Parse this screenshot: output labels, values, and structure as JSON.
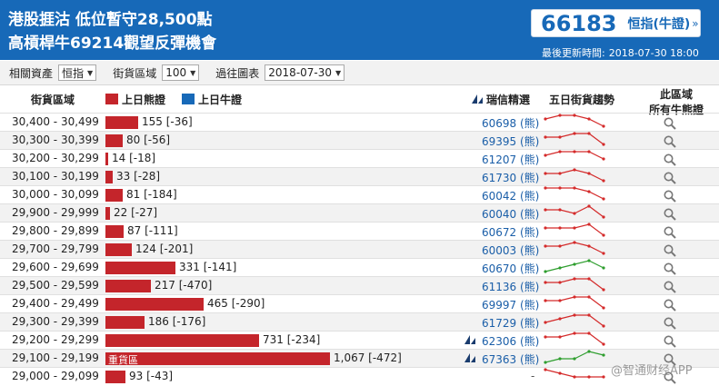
{
  "header": {
    "headline_1": "港股捱沽 低位暫守28,500點",
    "headline_2": "高槓桿牛69214觀望反彈機會",
    "quote_value": "66183",
    "quote_label": "恒指(牛證)",
    "quote_arrow": "»",
    "updated_label": "最後更新時間:",
    "updated_time": "2018-07-30 18:00"
  },
  "filters": {
    "asset_label": "相關資產",
    "asset_value": "恒指",
    "zone_label": "街貨區域",
    "zone_value": "100",
    "date_label": "過往圖表",
    "date_value": "2018-07-30"
  },
  "table_header": {
    "zone": "街貨區域",
    "legend_bear": "上日熊證",
    "legend_bull": "上日牛證",
    "rec": "瑞信精選",
    "trend": "五日街貨趨勢",
    "all_line1": "此區域",
    "all_line2": "所有牛熊證"
  },
  "colors": {
    "header_bg": "#1769b8",
    "bear": "#c4252b",
    "bull": "#1769b8",
    "trend_up": "#2e9e2e",
    "trend_down": "#d42a2a"
  },
  "rows": [
    {
      "range": "30,400 - 30,499",
      "bar": 155,
      "value": "155 [-36]",
      "code": "60698 (熊)",
      "flag": false,
      "bar_label": "",
      "trend": [
        3,
        4,
        4,
        3,
        1
      ],
      "up": false
    },
    {
      "range": "30,300 - 30,399",
      "bar": 80,
      "value": "80 [-56]",
      "code": "69395 (熊)",
      "flag": false,
      "bar_label": "",
      "trend": [
        3,
        3,
        4,
        4,
        1
      ],
      "up": false
    },
    {
      "range": "30,200 - 30,299",
      "bar": 14,
      "value": "14 [-18]",
      "code": "61207 (熊)",
      "flag": false,
      "bar_label": "",
      "trend": [
        3,
        4,
        4,
        4,
        2
      ],
      "up": false
    },
    {
      "range": "30,100 - 30,199",
      "bar": 33,
      "value": "33 [-28]",
      "code": "61730 (熊)",
      "flag": false,
      "bar_label": "",
      "trend": [
        3,
        3,
        4,
        3,
        1
      ],
      "up": false
    },
    {
      "range": "30,000 - 30,099",
      "bar": 81,
      "value": "81 [-184]",
      "code": "60042 (熊)",
      "flag": false,
      "bar_label": "",
      "trend": [
        4,
        4,
        4,
        3,
        1
      ],
      "up": false
    },
    {
      "range": "29,900 - 29,999",
      "bar": 22,
      "value": "22 [-27]",
      "code": "60040 (熊)",
      "flag": false,
      "bar_label": "",
      "trend": [
        3,
        3,
        2,
        4,
        1
      ],
      "up": false
    },
    {
      "range": "29,800 - 29,899",
      "bar": 87,
      "value": "87 [-111]",
      "code": "60672 (熊)",
      "flag": false,
      "bar_label": "",
      "trend": [
        3,
        3,
        3,
        4,
        1
      ],
      "up": false
    },
    {
      "range": "29,700 - 29,799",
      "bar": 124,
      "value": "124 [-201]",
      "code": "60003 (熊)",
      "flag": false,
      "bar_label": "",
      "trend": [
        3,
        3,
        4,
        3,
        1
      ],
      "up": false
    },
    {
      "range": "29,600 - 29,699",
      "bar": 331,
      "value": "331 [-141]",
      "code": "60670 (熊)",
      "flag": false,
      "bar_label": "",
      "trend": [
        1,
        2,
        3,
        4,
        2
      ],
      "up": true
    },
    {
      "range": "29,500 - 29,599",
      "bar": 217,
      "value": "217 [-470]",
      "code": "61136 (熊)",
      "flag": false,
      "bar_label": "",
      "trend": [
        3,
        3,
        4,
        4,
        1
      ],
      "up": false
    },
    {
      "range": "29,400 - 29,499",
      "bar": 465,
      "value": "465 [-290]",
      "code": "69997 (熊)",
      "flag": false,
      "bar_label": "",
      "trend": [
        3,
        3,
        4,
        4,
        1
      ],
      "up": false
    },
    {
      "range": "29,300 - 29,399",
      "bar": 186,
      "value": "186 [-176]",
      "code": "61729 (熊)",
      "flag": false,
      "bar_label": "",
      "trend": [
        2,
        3,
        4,
        4,
        1
      ],
      "up": false
    },
    {
      "range": "29,200 - 29,299",
      "bar": 731,
      "value": "731 [-234]",
      "code": "62306 (熊)",
      "flag": true,
      "bar_label": "",
      "trend": [
        3,
        3,
        4,
        4,
        1
      ],
      "up": false
    },
    {
      "range": "29,100 - 29,199",
      "bar": 1067,
      "value": "1,067 [-472]",
      "code": "67363 (熊)",
      "flag": true,
      "bar_label": "重貨區",
      "trend": [
        1,
        2,
        2,
        4,
        3
      ],
      "up": true
    },
    {
      "range": "29,000 - 29,099",
      "bar": 93,
      "value": "93 [-43]",
      "code": "-",
      "flag": false,
      "bar_label": "",
      "trend": [
        4,
        3,
        2,
        2,
        2
      ],
      "up": false
    }
  ],
  "watermark": "@智通财经APP"
}
